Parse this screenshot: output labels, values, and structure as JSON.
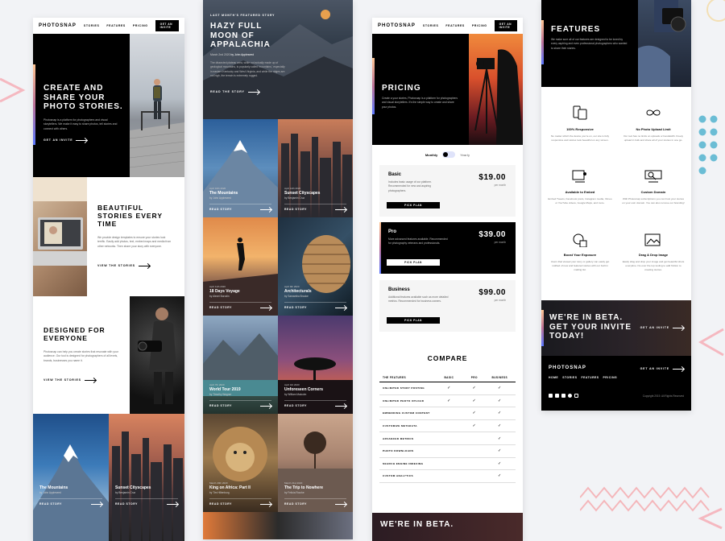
{
  "brand": "PHOTOSNAP",
  "nav": {
    "stories": "STORIES",
    "features": "FEATURES",
    "pricing": "PRICING",
    "invite": "GET AN INVITE"
  },
  "home": {
    "hero_title": "CREATE AND SHARE YOUR PHOTO STORIES.",
    "hero_text": "Photosnap is a platform for photographers and visual storytellers. We make it easy to share photos, tell stories and connect with others.",
    "hero_link": "GET AN INVITE",
    "beautiful_title": "BEAUTIFUL STORIES EVERY TIME",
    "beautiful_text": "We provide design templates to ensure your stories look terrific. Easily add photos, text, embed maps and media from other networks. Then share your story with everyone.",
    "beautiful_link": "VIEW THE STORIES",
    "designed_title": "DESIGNED FOR EVERYONE",
    "designed_text": "Photosnap can help you create stories that resonate with your audience. Our tool is designed for photographers of all levels, brands, businesses you name it.",
    "designed_link": "VIEW THE STORIES",
    "cards": [
      {
        "title": "The Mountains",
        "author": "by John Appleseed",
        "link": "READ STORY"
      },
      {
        "title": "Sunset Cityscapes",
        "author": "by Benjamin Cruz",
        "link": "READ STORY"
      }
    ]
  },
  "stories": {
    "eyebrow": "LAST MONTH'S FEATURED STORY",
    "title": "HAZY FULL MOON OF APPALACHIA",
    "meta_date": "March 2nd 2020",
    "meta_author": "by John Appleseed",
    "text": "The dissected plateau area, while not actually made up of geological mountains, is popularly called 'mountains,' especially in eastern Kentucky and West Virginia, and while the ridges are not high, the terrain is extremely rugged.",
    "link": "READ THE STORY",
    "cards": [
      {
        "date": "April 16th 2020",
        "title": "The Mountains",
        "author": "by John Appleseed",
        "link": "READ STORY"
      },
      {
        "date": "April 14th 2020",
        "title": "Sunset Cityscapes",
        "author": "by Benjamin Cruz",
        "link": "READ STORY"
      },
      {
        "date": "April 11th 2020",
        "title": "18 Days Voyage",
        "author": "by Alexei Borodin",
        "link": "READ STORY"
      },
      {
        "date": "April 9th 2020",
        "title": "Architecturals",
        "author": "by Samantha Brooke",
        "link": "READ STORY"
      },
      {
        "date": "April 7th 2020",
        "title": "World Tour 2019",
        "author": "by Timothy Wagner",
        "link": "READ STORY"
      },
      {
        "date": "April 3rd 2020",
        "title": "Unforeseen Corners",
        "author": "by William Malcolm",
        "link": "READ STORY"
      },
      {
        "date": "March 29th 2020",
        "title": "King on Africa: Part II",
        "author": "by Tim Hillenburg",
        "link": "READ STORY"
      },
      {
        "date": "March 21st 2020",
        "title": "The Trip to Nowhere",
        "author": "by Felicia Rourke",
        "link": "READ STORY"
      }
    ]
  },
  "pricing": {
    "title": "PRICING",
    "text": "Create a your stories, Photosnap is a platform for photographers and visual storytellers. It's the simple way to create and share your photos.",
    "monthly": "Monthly",
    "yearly": "Yearly",
    "plans": [
      {
        "name": "Basic",
        "text": "Includes basic usage of our platform. Recommended for new and aspiring photographers.",
        "price": "$19.00",
        "per": "per month",
        "button": "PICK PLAN"
      },
      {
        "name": "Pro",
        "text": "More advanced features available. Recommended for photography veterans and professionals.",
        "price": "$39.00",
        "per": "per month",
        "button": "PICK PLAN"
      },
      {
        "name": "Business",
        "text": "Additional features available such as more detailed metrics. Recommended for business owners.",
        "price": "$99.00",
        "per": "per month",
        "button": "PICK PLAN"
      }
    ],
    "compare_title": "COMPARE",
    "table_headers": [
      "THE FEATURES",
      "BASIC",
      "PRO",
      "BUSINESS"
    ],
    "table_rows": [
      {
        "feature": "UNLIMITED STORY POSTING",
        "basic": true,
        "pro": true,
        "business": true
      },
      {
        "feature": "UNLIMITED PHOTO UPLOAD",
        "basic": true,
        "pro": true,
        "business": true
      },
      {
        "feature": "EMBEDDING CUSTOM CONTENT",
        "basic": false,
        "pro": true,
        "business": true
      },
      {
        "feature": "CUSTOMIZE METADATA",
        "basic": false,
        "pro": true,
        "business": true
      },
      {
        "feature": "ADVANCED METRICS",
        "basic": false,
        "pro": false,
        "business": true
      },
      {
        "feature": "PHOTO DOWNLOADS",
        "basic": false,
        "pro": false,
        "business": true
      },
      {
        "feature": "SEARCH ENGINE INDEXING",
        "basic": false,
        "pro": false,
        "business": true
      },
      {
        "feature": "CUSTOM ANALYTICS",
        "basic": false,
        "pro": false,
        "business": true
      }
    ],
    "beta": "WE'RE IN BETA."
  },
  "features": {
    "title": "FEATURES",
    "text": "We make sure all of our features are designed to be loved by every aspiring and even professional photographers who wanted to share their stories.",
    "items": [
      {
        "icon": "responsive-icon",
        "title": "100% Responsive",
        "text": "No matter which the device you're on, our site is fully responsive and stories look beautiful on any screen."
      },
      {
        "icon": "infinity-icon",
        "title": "No Photo Upload Limit",
        "text": "Our tool has no limits on uploads or bandwidth. Freely upload in bulk and share all of your stories in one go."
      },
      {
        "icon": "embed-icon",
        "title": "Available to Embed",
        "text": "Embed Tweets, Facebook posts, Instagram media, Vimeo or YouTube videos, Google Maps, and more."
      },
      {
        "icon": "custom-domain-icon",
        "title": "Custom Domain",
        "text": "With Photosnap subscriptions you can host your stories on your own domain. You can also remove our branding!"
      },
      {
        "icon": "boost-icon",
        "title": "Boost Your Exposure",
        "text": "Users that viewed your story or gallery can easily get notified of new and featured stories with our built in mailing list."
      },
      {
        "icon": "drag-drop-icon",
        "title": "Drag & Drop Image",
        "text": "Easily drag and drop your image and get beautiful shots everytime. No over the top tooling to add friction to creating stories."
      }
    ],
    "beta_title": "WE'RE IN BETA. GET YOUR INVITE TODAY!",
    "beta_link": "GET AN INVITE",
    "footer_invite": "GET AN INVITE",
    "footer_nav": [
      "HOME",
      "STORIES",
      "FEATURES",
      "PRICING"
    ],
    "copyright": "Copyright 2019. All Rights Reserved"
  }
}
